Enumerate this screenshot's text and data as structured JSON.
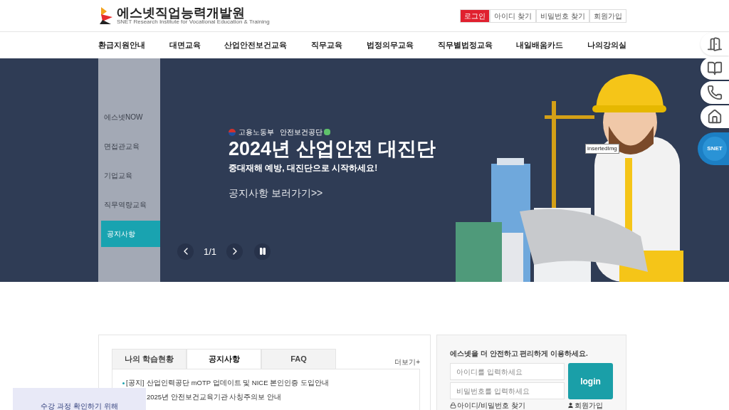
{
  "header": {
    "logo_title": "에스넷직업능력개발원",
    "logo_subtitle": "SNET Research Institute for Vocational Education & Training",
    "top_links": [
      {
        "label": "로그인",
        "selected": true
      },
      {
        "label": "아이디 찾기",
        "selected": false
      },
      {
        "label": "비밀번호 찾기",
        "selected": false
      },
      {
        "label": "회원가입",
        "selected": false
      }
    ]
  },
  "nav": [
    "환급지원안내",
    "대면교육",
    "산업안전보건교육",
    "직무교육",
    "법정의무교육",
    "직무별법정교육",
    "내일배움카드",
    "나의강의실"
  ],
  "banner": {
    "side_menu": [
      {
        "label": "에스넷NOW",
        "selected": false
      },
      {
        "label": "면접관교육",
        "selected": false
      },
      {
        "label": "기업교육",
        "selected": false
      },
      {
        "label": "직무역량교육",
        "selected": false
      },
      {
        "label": "공지사항",
        "selected": true
      }
    ],
    "org_logos": [
      "고용노동부",
      "안전보건공단"
    ],
    "headline": "2024년 산업안전 대진단",
    "subtitle": "중대재해 예방, 대진단으로 시작하세요!",
    "link": "공지사항 보러가기>>",
    "counter": "1/1",
    "tooltip": "insertedImg"
  },
  "quick_menu": [
    {
      "kind": "door"
    },
    {
      "kind": "book"
    },
    {
      "kind": "phone"
    },
    {
      "kind": "home"
    },
    {
      "kind": "brand",
      "label": "SNET"
    }
  ],
  "board": {
    "tabs": [
      {
        "label": "나의 학습현황",
        "selected": false
      },
      {
        "label": "공지사항",
        "selected": true
      },
      {
        "label": "FAQ",
        "selected": false
      }
    ],
    "more": "더보기+",
    "items": [
      {
        "tag": "[공지]",
        "title": "산업인력공단 mOTP 업데이트 및 NICE 본인인증 도입안내"
      },
      {
        "title": "2025년 안전보건교육기관 사칭주의보 안내"
      }
    ]
  },
  "login": {
    "title": "에스넷을 더 안전하고 편리하게 이용하세요.",
    "id_placeholder": "아이디를 입력하세요",
    "pw_placeholder": "비밀번호를 입력하세요",
    "button": "login",
    "find": "아이디/비밀번호 찾기",
    "join": "회원가입"
  },
  "popup": {
    "text": "수강 과정 확인하기 위해"
  }
}
